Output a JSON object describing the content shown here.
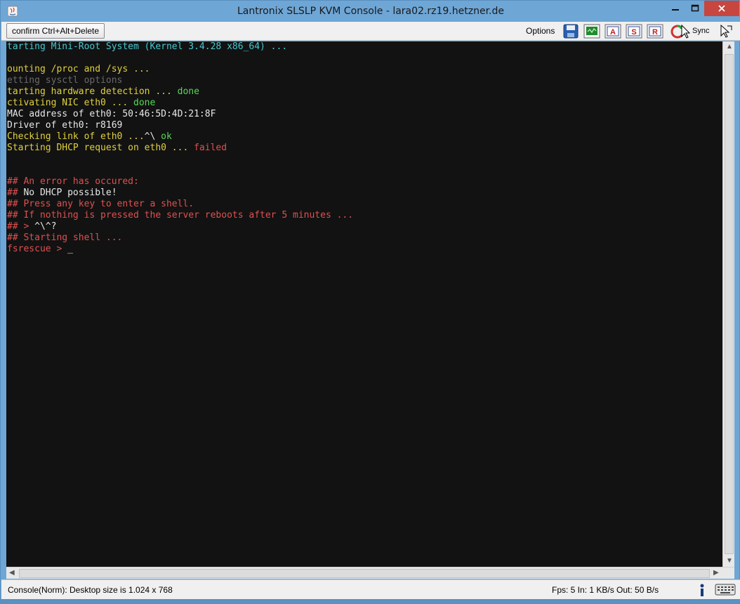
{
  "window": {
    "title": "Lantronix SLSLP KVM Console - lara02.rz19.hetzner.de"
  },
  "toolbar": {
    "cad_label": "confirm Ctrl+Alt+Delete",
    "options_label": "Options",
    "sync_label": "Sync",
    "icons": [
      "save-icon",
      "monitor-icon",
      "macro-a-icon",
      "macro-s-icon",
      "macro-r-icon",
      "sync-icon",
      "mouse-pointer-icon"
    ]
  },
  "terminal": {
    "lines": [
      {
        "segments": [
          {
            "text": "tarting Mini-Root System (Kernel 3.4.28 x86_64) ...",
            "color": "cyan"
          }
        ]
      },
      {
        "segments": [
          {
            "text": "",
            "color": "white"
          }
        ]
      },
      {
        "segments": [
          {
            "text": "ounting /proc and /sys ...",
            "color": "yellow"
          }
        ]
      },
      {
        "segments": [
          {
            "text": "etting sysctl options",
            "color": "gray"
          }
        ]
      },
      {
        "segments": [
          {
            "text": "tarting hardware detection ... ",
            "color": "yellow"
          },
          {
            "text": "done",
            "color": "green"
          }
        ]
      },
      {
        "segments": [
          {
            "text": "ctivating NIC eth0 ... ",
            "color": "yellow"
          },
          {
            "text": "done",
            "color": "green"
          }
        ]
      },
      {
        "segments": [
          {
            "text": "MAC address of eth0: 50:46:5D:4D:21:8F",
            "color": "white"
          }
        ]
      },
      {
        "segments": [
          {
            "text": "Driver of eth0: r8169",
            "color": "white"
          }
        ]
      },
      {
        "segments": [
          {
            "text": "Checking link of eth0 ...",
            "color": "yellow"
          },
          {
            "text": "^\\ ",
            "color": "white"
          },
          {
            "text": "ok",
            "color": "green"
          }
        ]
      },
      {
        "segments": [
          {
            "text": "Starting DHCP request on eth0 ... ",
            "color": "yellow"
          },
          {
            "text": "failed",
            "color": "red"
          }
        ]
      },
      {
        "segments": [
          {
            "text": "",
            "color": "white"
          }
        ]
      },
      {
        "segments": [
          {
            "text": "",
            "color": "white"
          }
        ]
      },
      {
        "segments": [
          {
            "text": "## An error has occured:",
            "color": "red"
          }
        ]
      },
      {
        "segments": [
          {
            "text": "## ",
            "color": "red"
          },
          {
            "text": "No DHCP possible!",
            "color": "white"
          }
        ]
      },
      {
        "segments": [
          {
            "text": "## Press any key to enter a shell.",
            "color": "red"
          }
        ]
      },
      {
        "segments": [
          {
            "text": "## If nothing is pressed the server reboots after 5 minutes ...",
            "color": "red"
          }
        ]
      },
      {
        "segments": [
          {
            "text": "## > ",
            "color": "red"
          },
          {
            "text": "^\\^?",
            "color": "white"
          }
        ]
      },
      {
        "segments": [
          {
            "text": "## Starting shell ...",
            "color": "red"
          }
        ]
      },
      {
        "segments": [
          {
            "text": "fsrescue > ",
            "color": "red"
          },
          {
            "text": "_",
            "color": "white"
          }
        ]
      }
    ]
  },
  "status": {
    "left": "Console(Norm): Desktop size is 1.024 x 768",
    "right": "Fps: 5 In: 1 KB/s Out: 50 B/s"
  },
  "colors": {
    "cyan": "#44c8d0",
    "yellow": "#e0d040",
    "gray": "#6a6a6a",
    "green": "#58d858",
    "white": "#e8e8e8",
    "red": "#e05050"
  }
}
